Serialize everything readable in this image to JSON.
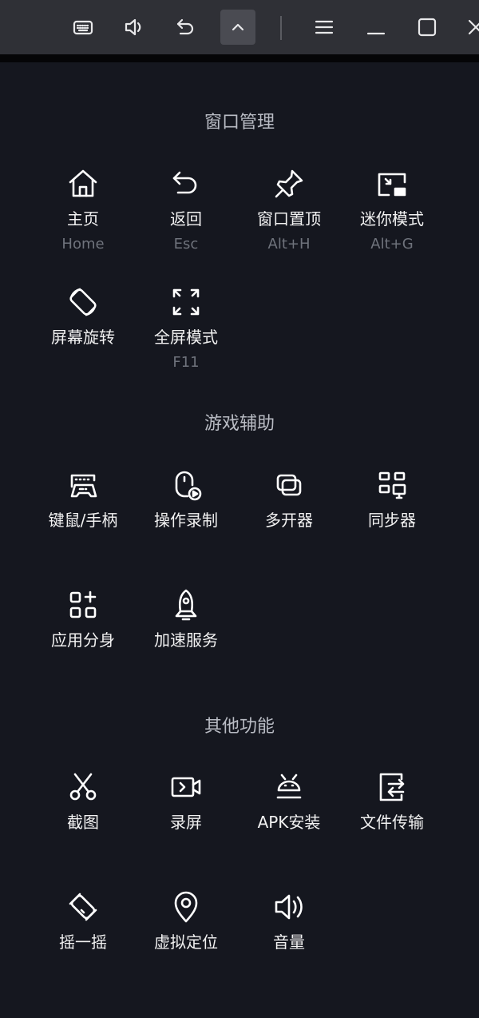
{
  "toolbar": {
    "buttons": [
      {
        "name": "keyboard",
        "icon": "keyboard-icon"
      },
      {
        "name": "volume",
        "icon": "volume-icon"
      },
      {
        "name": "back",
        "icon": "undo-icon"
      },
      {
        "name": "collapse",
        "icon": "chevron-up-icon",
        "active": true
      },
      {
        "name": "menu",
        "icon": "menu-icon"
      },
      {
        "name": "minimize",
        "icon": "minimize-icon"
      },
      {
        "name": "maximize",
        "icon": "maximize-icon"
      },
      {
        "name": "close",
        "icon": "close-icon"
      }
    ]
  },
  "sections": [
    {
      "title": "窗口管理",
      "rows": [
        [
          {
            "label": "主页",
            "shortcut": "Home",
            "icon": "home"
          },
          {
            "label": "返回",
            "shortcut": "Esc",
            "icon": "back"
          },
          {
            "label": "窗口置顶",
            "shortcut": "Alt+H",
            "icon": "pin"
          },
          {
            "label": "迷你模式",
            "shortcut": "Alt+G",
            "icon": "mini"
          }
        ],
        [
          {
            "label": "屏幕旋转",
            "icon": "rotate"
          },
          {
            "label": "全屏模式",
            "shortcut": "F11",
            "icon": "fullscreen"
          }
        ]
      ]
    },
    {
      "title": "游戏辅助",
      "rows": [
        [
          {
            "label": "键鼠/手柄",
            "icon": "gamepad"
          },
          {
            "label": "操作录制",
            "icon": "record-op"
          },
          {
            "label": "多开器",
            "icon": "multi"
          },
          {
            "label": "同步器",
            "icon": "sync"
          }
        ],
        [
          {
            "label": "应用分身",
            "icon": "clone"
          },
          {
            "label": "加速服务",
            "icon": "rocket"
          }
        ]
      ]
    },
    {
      "title": "其他功能",
      "rows": [
        [
          {
            "label": "截图",
            "icon": "scissors"
          },
          {
            "label": "录屏",
            "icon": "video"
          },
          {
            "label": "APK安装",
            "icon": "android"
          },
          {
            "label": "文件传输",
            "icon": "transfer"
          }
        ],
        [
          {
            "label": "摇一摇",
            "icon": "shake"
          },
          {
            "label": "虚拟定位",
            "icon": "location"
          },
          {
            "label": "音量",
            "icon": "volume"
          }
        ]
      ]
    }
  ]
}
